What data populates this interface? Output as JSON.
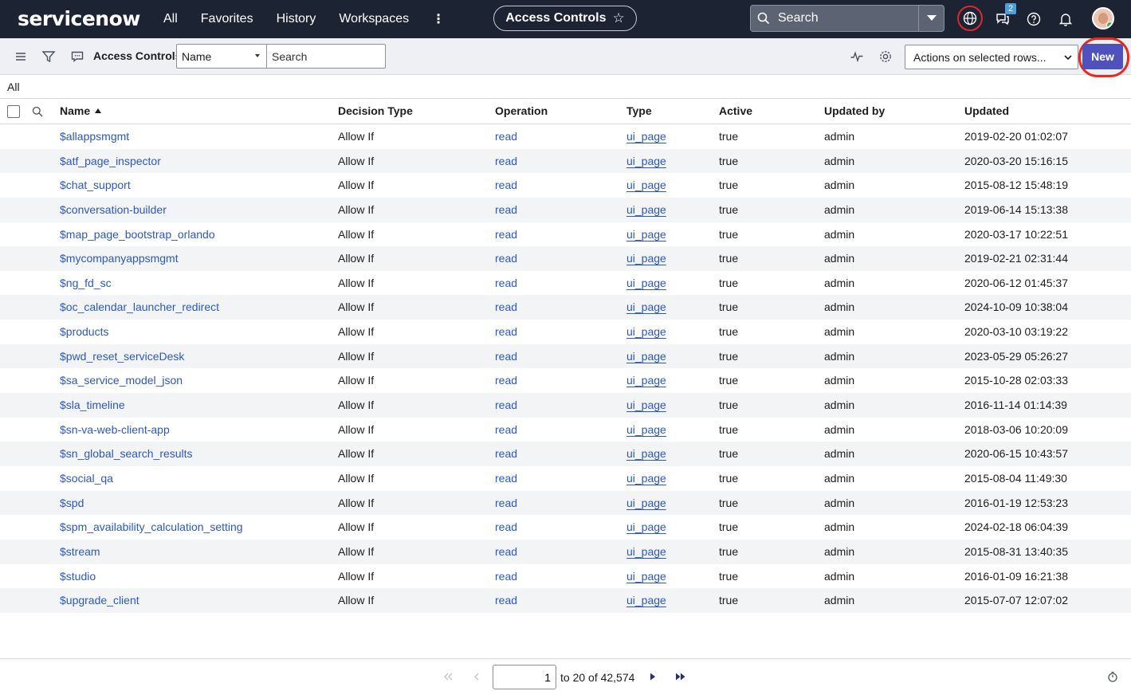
{
  "nav": {
    "logo": "servicenow",
    "links": [
      "All",
      "Favorites",
      "History",
      "Workspaces"
    ],
    "more": "⋮",
    "pill_title": "Access Controls",
    "search_label": "Search",
    "notification_badge": "2"
  },
  "listbar": {
    "title": "Access Controls",
    "field_selected": "Name",
    "search_placeholder": "Search",
    "actions_label": "Actions on selected rows...",
    "new_label": "New"
  },
  "breadcrumb": "All",
  "table": {
    "headers": {
      "name": "Name",
      "decision": "Decision Type",
      "operation": "Operation",
      "type": "Type",
      "active": "Active",
      "updated_by": "Updated by",
      "updated": "Updated"
    },
    "rows": [
      {
        "name": "$allappsmgmt",
        "decision": "Allow If",
        "operation": "read",
        "type": "ui_page",
        "active": "true",
        "updated_by": "admin",
        "updated": "2019-02-20 01:02:07"
      },
      {
        "name": "$atf_page_inspector",
        "decision": "Allow If",
        "operation": "read",
        "type": "ui_page",
        "active": "true",
        "updated_by": "admin",
        "updated": "2020-03-20 15:16:15"
      },
      {
        "name": "$chat_support",
        "decision": "Allow If",
        "operation": "read",
        "type": "ui_page",
        "active": "true",
        "updated_by": "admin",
        "updated": "2015-08-12 15:48:19"
      },
      {
        "name": "$conversation-builder",
        "decision": "Allow If",
        "operation": "read",
        "type": "ui_page",
        "active": "true",
        "updated_by": "admin",
        "updated": "2019-06-14 15:13:38"
      },
      {
        "name": "$map_page_bootstrap_orlando",
        "decision": "Allow If",
        "operation": "read",
        "type": "ui_page",
        "active": "true",
        "updated_by": "admin",
        "updated": "2020-03-17 10:22:51"
      },
      {
        "name": "$mycompanyappsmgmt",
        "decision": "Allow If",
        "operation": "read",
        "type": "ui_page",
        "active": "true",
        "updated_by": "admin",
        "updated": "2019-02-21 02:31:44"
      },
      {
        "name": "$ng_fd_sc",
        "decision": "Allow If",
        "operation": "read",
        "type": "ui_page",
        "active": "true",
        "updated_by": "admin",
        "updated": "2020-06-12 01:45:37"
      },
      {
        "name": "$oc_calendar_launcher_redirect",
        "decision": "Allow If",
        "operation": "read",
        "type": "ui_page",
        "active": "true",
        "updated_by": "admin",
        "updated": "2024-10-09 10:38:04"
      },
      {
        "name": "$products",
        "decision": "Allow If",
        "operation": "read",
        "type": "ui_page",
        "active": "true",
        "updated_by": "admin",
        "updated": "2020-03-10 03:19:22"
      },
      {
        "name": "$pwd_reset_serviceDesk",
        "decision": "Allow If",
        "operation": "read",
        "type": "ui_page",
        "active": "true",
        "updated_by": "admin",
        "updated": "2023-05-29 05:26:27"
      },
      {
        "name": "$sa_service_model_json",
        "decision": "Allow If",
        "operation": "read",
        "type": "ui_page",
        "active": "true",
        "updated_by": "admin",
        "updated": "2015-10-28 02:03:33"
      },
      {
        "name": "$sla_timeline",
        "decision": "Allow If",
        "operation": "read",
        "type": "ui_page",
        "active": "true",
        "updated_by": "admin",
        "updated": "2016-11-14 01:14:39"
      },
      {
        "name": "$sn-va-web-client-app",
        "decision": "Allow If",
        "operation": "read",
        "type": "ui_page",
        "active": "true",
        "updated_by": "admin",
        "updated": "2018-03-06 10:20:09"
      },
      {
        "name": "$sn_global_search_results",
        "decision": "Allow If",
        "operation": "read",
        "type": "ui_page",
        "active": "true",
        "updated_by": "admin",
        "updated": "2020-06-15 10:43:57"
      },
      {
        "name": "$social_qa",
        "decision": "Allow If",
        "operation": "read",
        "type": "ui_page",
        "active": "true",
        "updated_by": "admin",
        "updated": "2015-08-04 11:49:30"
      },
      {
        "name": "$spd",
        "decision": "Allow If",
        "operation": "read",
        "type": "ui_page",
        "active": "true",
        "updated_by": "admin",
        "updated": "2016-01-19 12:53:23"
      },
      {
        "name": "$spm_availability_calculation_setting",
        "decision": "Allow If",
        "operation": "read",
        "type": "ui_page",
        "active": "true",
        "updated_by": "admin",
        "updated": "2024-02-18 06:04:39"
      },
      {
        "name": "$stream",
        "decision": "Allow If",
        "operation": "read",
        "type": "ui_page",
        "active": "true",
        "updated_by": "admin",
        "updated": "2015-08-31 13:40:35"
      },
      {
        "name": "$studio",
        "decision": "Allow If",
        "operation": "read",
        "type": "ui_page",
        "active": "true",
        "updated_by": "admin",
        "updated": "2016-01-09 16:21:38"
      },
      {
        "name": "$upgrade_client",
        "decision": "Allow If",
        "operation": "read",
        "type": "ui_page",
        "active": "true",
        "updated_by": "admin",
        "updated": "2015-07-07 12:07:02"
      }
    ]
  },
  "pagination": {
    "current": "1",
    "range_text": "to 20 of 42,574"
  },
  "colors": {
    "nav_bg": "#1c2333",
    "link": "#2b57c9",
    "new_button": "#4f52bd",
    "highlight_ring": "#ea2a1d"
  },
  "icons": [
    "menu-icon",
    "filter-icon",
    "chat-icon",
    "search-icon",
    "globe-icon",
    "speech-bubble-icon",
    "help-icon",
    "bell-icon",
    "activity-icon",
    "gear-icon",
    "first-page-icon",
    "prev-page-icon",
    "next-page-icon",
    "last-page-icon",
    "timer-icon"
  ]
}
